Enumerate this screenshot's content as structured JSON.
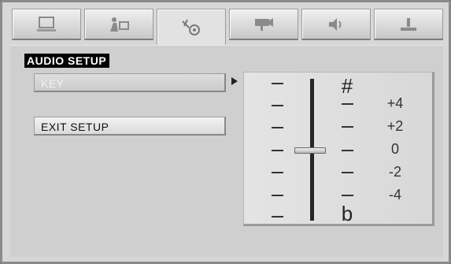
{
  "tabs": [
    {
      "icon": "monitor-icon",
      "active": false
    },
    {
      "icon": "language-icon",
      "active": false
    },
    {
      "icon": "audio-setup-icon",
      "active": true
    },
    {
      "icon": "video-icon",
      "active": false
    },
    {
      "icon": "speaker-icon",
      "active": false
    },
    {
      "icon": "preference-icon",
      "active": false
    }
  ],
  "section_title": "AUDIO SETUP",
  "menu": {
    "key_label": "KEY",
    "exit_label": "EXIT SETUP"
  },
  "key_panel": {
    "sharp_symbol": "#",
    "flat_symbol": "b",
    "levels": [
      "+4",
      "+2",
      "0",
      "-2",
      "-4"
    ],
    "selected_level": "0"
  }
}
